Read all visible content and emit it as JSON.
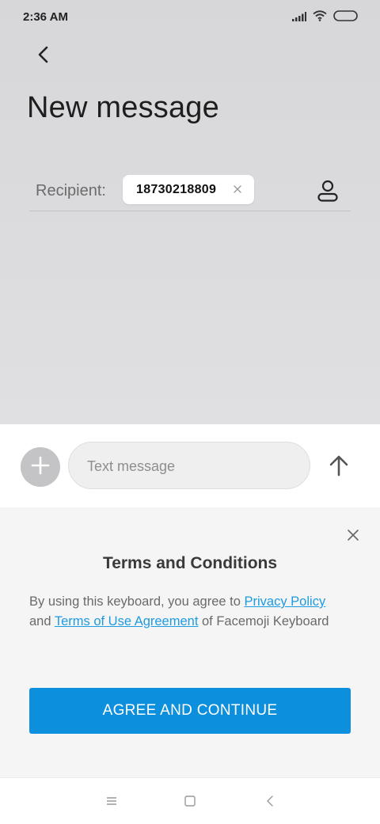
{
  "status_bar": {
    "time": "2:36 AM",
    "icons": [
      "signal-icon",
      "wifi-icon",
      "battery-icon"
    ]
  },
  "header": {
    "back_icon": "back-arrow-icon",
    "title": "New message"
  },
  "recipient": {
    "label": "Recipient:",
    "chip_value": "18730218809",
    "chip_close_icon": "close-icon",
    "contact_icon": "contact-icon"
  },
  "compose": {
    "add_icon": "plus-icon",
    "placeholder": "Text message",
    "value": "",
    "send_icon": "send-arrow-icon"
  },
  "terms": {
    "close_icon": "close-icon",
    "title": "Terms and Conditions",
    "body_prefix": "By using this keyboard, you agree to ",
    "privacy_link": "Privacy Policy",
    "body_and": " and ",
    "terms_link": "Terms of Use Agreement",
    "body_suffix": " of Facemoji Keyboard",
    "agree_button": "AGREE AND CONTINUE"
  },
  "colors": {
    "accent": "#0c8fdc",
    "link": "#1e9be0",
    "background_top": "#dcdcde"
  },
  "nav": {
    "items": [
      "menu-icon",
      "home-icon",
      "back-icon"
    ]
  }
}
